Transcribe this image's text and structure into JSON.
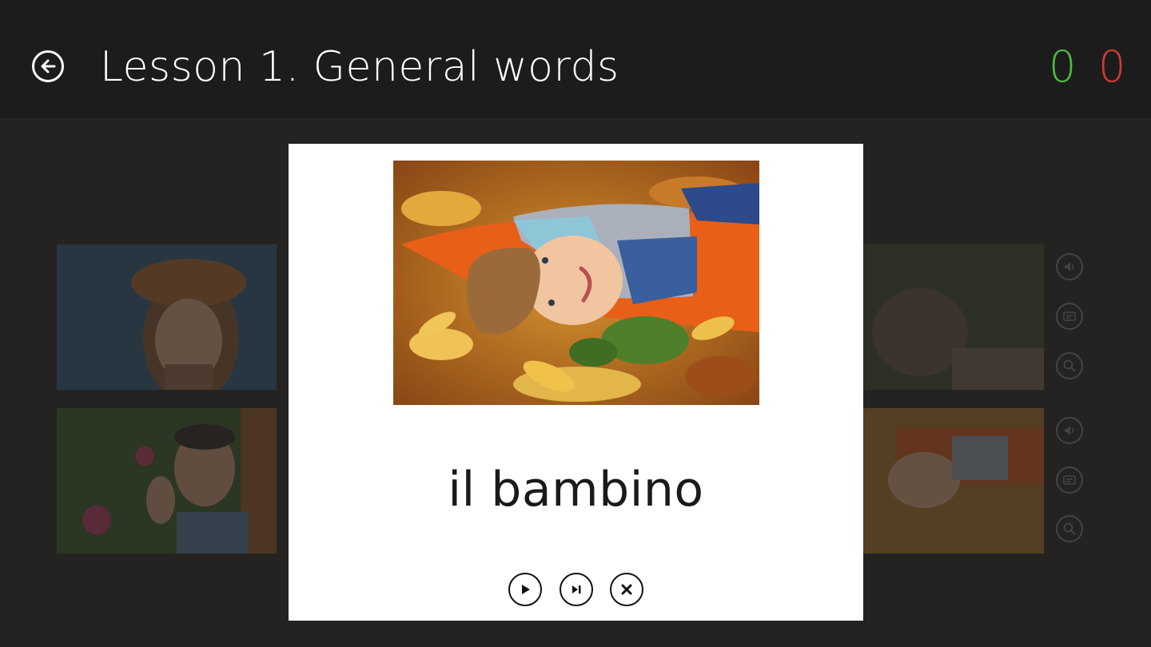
{
  "header": {
    "title": "Lesson 1. General words",
    "back_icon": "back-arrow-icon",
    "score_correct": "0",
    "score_wrong": "0",
    "colors": {
      "correct": "#4cbb3f",
      "wrong": "#d03a33"
    }
  },
  "card": {
    "word": "il bambino",
    "image": "boy-lying-in-autumn-leaves",
    "controls": [
      {
        "icon": "play-icon"
      },
      {
        "icon": "skip-next-icon"
      },
      {
        "icon": "close-icon"
      }
    ]
  },
  "background_tiles": [
    {
      "image": "woman-in-hat-photo"
    },
    {
      "image": "man-on-phone-photo"
    },
    {
      "image": "animal-in-forest-photo"
    },
    {
      "image": "boy-in-leaves-photo"
    }
  ],
  "side_actions": [
    {
      "icon": "speaker-icon"
    },
    {
      "icon": "card-icon"
    },
    {
      "icon": "magnifier-icon"
    }
  ]
}
